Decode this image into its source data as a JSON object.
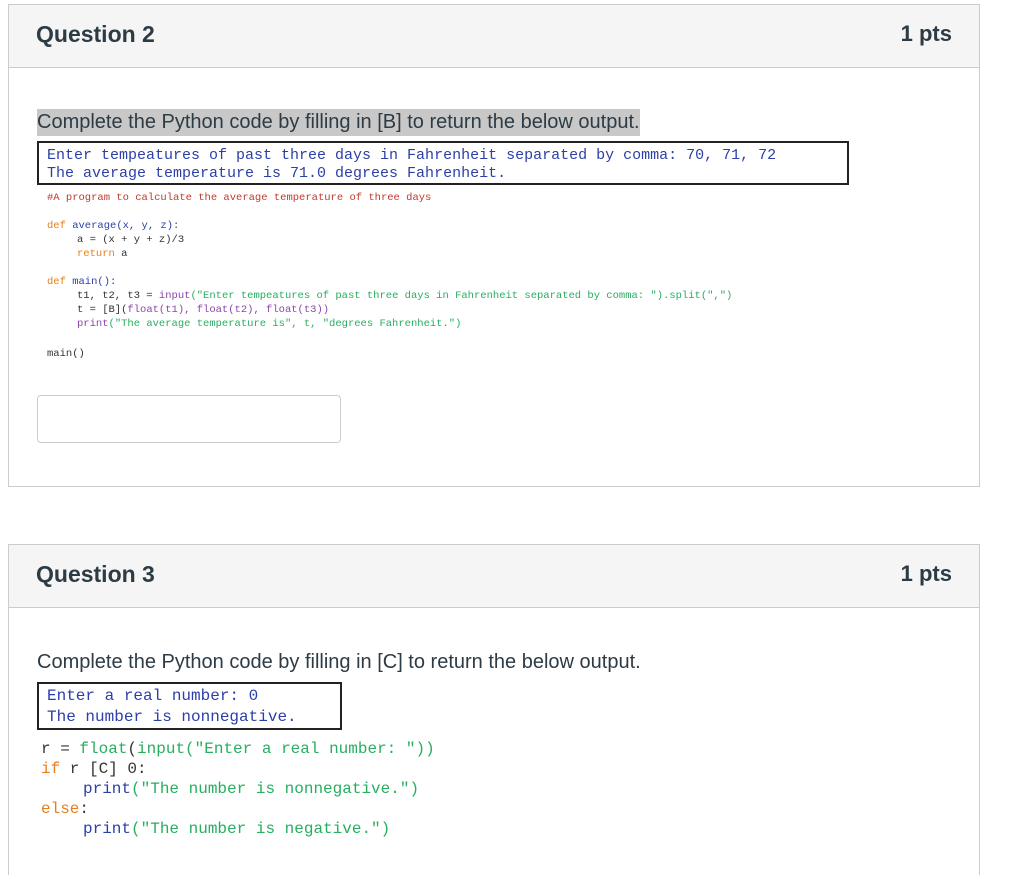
{
  "questions": [
    {
      "title": "Question 2",
      "points": "1 pts",
      "prompt": "Complete the Python code by filling in [B] to return the below output.",
      "output_lines": [
        "Enter tempeatures of past three days in Fahrenheit separated by comma: 70, 71, 72",
        "The average temperature is 71.0 degrees Fahrenheit."
      ],
      "code": {
        "comment": "#A program to calculate the average temperature of three days",
        "def1_kw": "def",
        "def1_sig": " average(x, y, z):",
        "line_a": "a = (x + y + z)/3",
        "ret_kw": "return",
        "ret_val": " a",
        "def2_kw": "def",
        "def2_sig": " main():",
        "input_lhs": "t1, t2, t3 = ",
        "input_fn": "input",
        "input_arg": "(\"Enter tempeatures of past three days in Fahrenheit separated by comma: \").split(\",\")",
        "t_lhs": "t = [B](",
        "t_args": "float(t1), float(t2), float(t3))",
        "print_fn": "print",
        "print_arg": "(\"The average temperature is\", t, \"degrees Fahrenheit.\")",
        "main_call": "main()"
      },
      "answer_value": ""
    },
    {
      "title": "Question 3",
      "points": "1 pts",
      "prompt": "Complete the Python code by filling in [C] to return the below output.",
      "output_lines": [
        "Enter a real number: 0",
        "The number is nonnegative."
      ],
      "code": {
        "l1_a": "r = ",
        "l1_b": "float",
        "l1_c": "(",
        "l1_d": "input",
        "l1_e": "(\"Enter a real number: \"))",
        "l2_kw": "if",
        "l2_rest": " r [C] 0:",
        "l3_fn": "print",
        "l3_arg": "(\"The number is nonnegative.\")",
        "l4_kw": "else",
        "l4_rest": ":",
        "l5_fn": "print",
        "l5_arg": "(\"The number is negative.\")"
      }
    }
  ]
}
